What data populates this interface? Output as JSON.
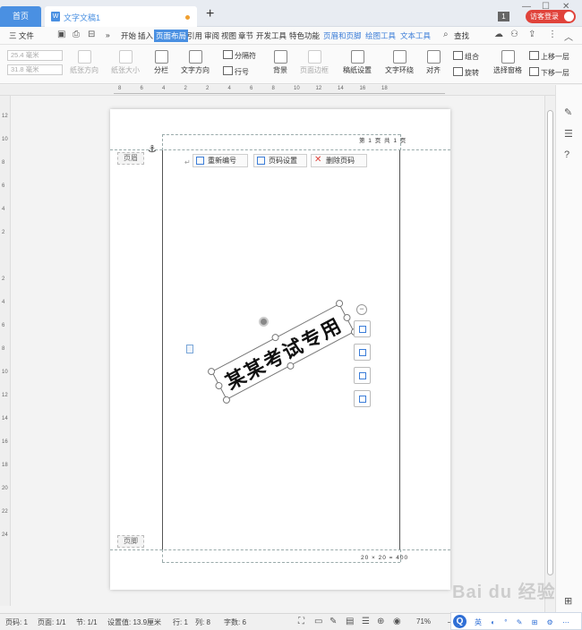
{
  "titlebar": {
    "home_tab": "首页",
    "doc_tab": "文字文稿1",
    "doc_icon": "W",
    "add_tab": "+",
    "badge": "1",
    "login": "访客登录",
    "win_min": "—",
    "win_max": "☐",
    "win_close": "✕"
  },
  "menubar": {
    "file": "三 文件",
    "more": "»",
    "items": [
      "开始",
      "插入",
      "页面布局",
      "引用",
      "审阅",
      "视图",
      "章节",
      "开发工具",
      "特色功能",
      "页眉和页脚",
      "绘图工具",
      "文本工具"
    ],
    "active": "页面布局",
    "search": "查找"
  },
  "ribbon": {
    "width_field": "25.4 毫米",
    "height_field": "31.8 毫米",
    "paper_orientation": "纸张方向",
    "paper_size": "纸张大小",
    "columns": "分栏",
    "text_direction": "文字方向",
    "separator": "分隔符",
    "line_number": "行号",
    "background": "背景",
    "page_border": "页面边框",
    "draft_settings": "稿纸设置",
    "text_wrap": "文字环绕",
    "align": "对齐",
    "group": "组合",
    "rotate": "旋转",
    "selection_pane": "选择窗格",
    "bring_forward": "上移一层",
    "send_backward": "下移一层"
  },
  "hruler": {
    "labels": [
      "8",
      "6",
      "4",
      "2",
      "2",
      "4",
      "6",
      "8",
      "10",
      "12",
      "14",
      "16",
      "18"
    ]
  },
  "vruler": {
    "labels": [
      "12",
      "10",
      "8",
      "6",
      "4",
      "2",
      "",
      "2",
      "4",
      "6",
      "8",
      "10",
      "12",
      "14",
      "16",
      "18",
      "20",
      "22",
      "24"
    ]
  },
  "page": {
    "header_label": "页眉",
    "footer_label": "页脚",
    "page_number_header": "第 1 页 共 1 页",
    "footer_text": "20 × 20 = 400"
  },
  "header_tools": {
    "renumber": "重新编号",
    "page_setup": "页码设置",
    "delete_page_number": "删除页码"
  },
  "watermark": {
    "text": "某某考试专用"
  },
  "statusbar": {
    "page_code": "页码: 1",
    "pages": "页面: 1/1",
    "section": "节: 1/1",
    "setting": "设置值: 13.9厘米",
    "line": "行: 1",
    "col": "列: 8",
    "words": "字数: 6",
    "zoom": "71%"
  },
  "ime": {
    "logo": "Q",
    "text": "英 ◐ ° ✎ ⊞ ⚙ ⋯"
  },
  "overlay": {
    "baidu": "Bai du 经验"
  },
  "colors": {
    "accent": "#4a90e2",
    "login": "#e0433b",
    "page": "#ffffff",
    "canvas": "#f3f3f3"
  }
}
